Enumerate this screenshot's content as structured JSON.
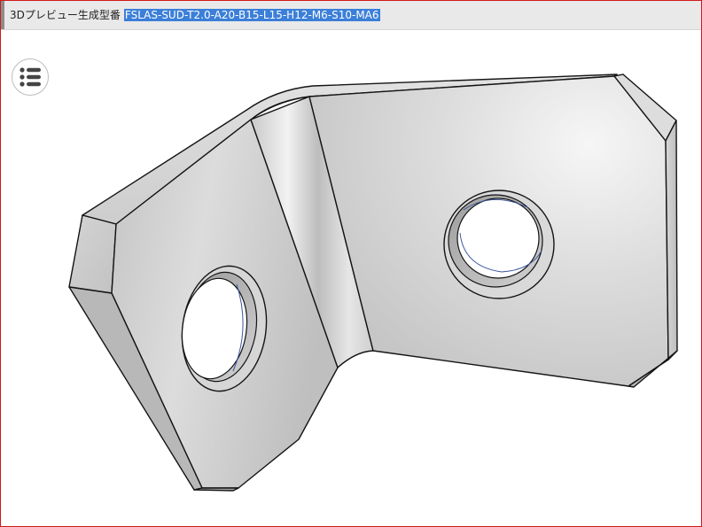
{
  "title_bar": {
    "label": "3Dプレビュー生成型番",
    "part_number": "FSLAS-SUD-T2.0-A20-B15-L15-H12-M6-S10-MA6"
  },
  "toolbar": {
    "menu_icon": "list-menu-icon"
  },
  "viewer": {
    "model": "l-angle-bracket-3d-render",
    "colors": {
      "frame_border": "#d01818",
      "selection_highlight": "#3b7fd8",
      "title_background": "#e9e9e9"
    }
  }
}
